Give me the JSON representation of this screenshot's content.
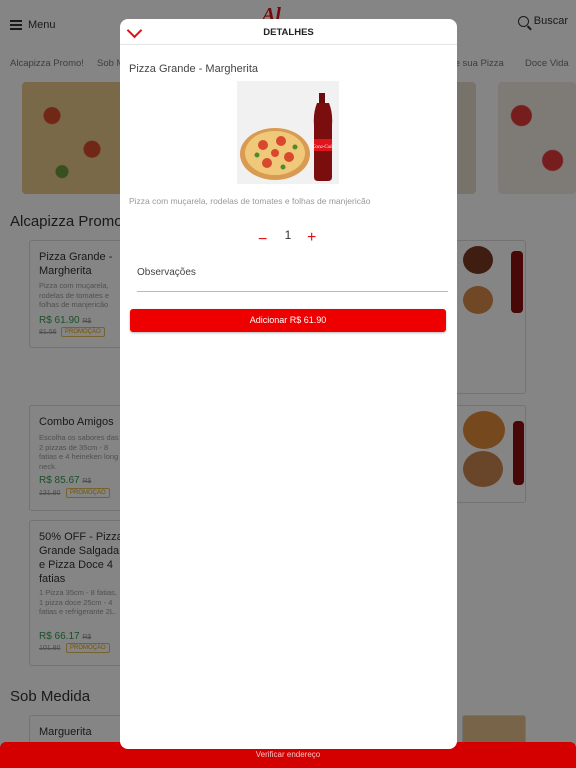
{
  "header": {
    "menu_label": "Menu",
    "logo_text": "Al",
    "search_label": "Buscar"
  },
  "categories": [
    "Alcapizza Promo!",
    "Sob M",
    "te sua Pizza",
    "Doce Vida"
  ],
  "sections": {
    "promo_title": "Alcapizza Promo!",
    "sob_medida_title": "Sob Medida"
  },
  "cards": [
    {
      "title": "Pizza Grande - Margherita",
      "desc": "Pizza com muçarela, rodelas de tomates e folhas de manjericão",
      "price": "R$ 61.90",
      "price_suffix": "R$",
      "old_price": "81.56",
      "badge": "PROMOÇÃO"
    },
    {
      "title": "Combo Amigos",
      "desc": "Escolha os sabores das 2 pizzas de 35cm - 8 fatias e 4 heineken long neck.",
      "price": "R$ 85.67",
      "price_suffix": "R$",
      "old_price": "131.80",
      "badge": "PROMOÇÃO"
    },
    {
      "title": "50% OFF - Pizza Grande Salgada e Pizza Doce 4 fatias",
      "desc": "1 Pizza 35cm - 8 fatias, 1 pizza doce 25cm - 4 fatias e refrigerante 2L.",
      "price": "R$ 66.17",
      "price_suffix": "R$",
      "old_price": "101.80",
      "badge": "PROMOÇÃO"
    },
    {
      "title": "Marguerita"
    }
  ],
  "bottom_bar": "Verificar endereço",
  "modal": {
    "title": "DETALHES",
    "product_name": "Pizza Grande - Margherita",
    "description": "Pizza com muçarela, rodelas de tomates e folhas de manjericão",
    "quantity": "1",
    "minus": "−",
    "plus": "+",
    "observations_label": "Observações",
    "add_button": "Adicionar R$ 61.90",
    "cola_label": "Coca-Cola"
  },
  "colors": {
    "accent": "#e01010",
    "button": "#ee0000",
    "price": "#2e9e4f"
  }
}
